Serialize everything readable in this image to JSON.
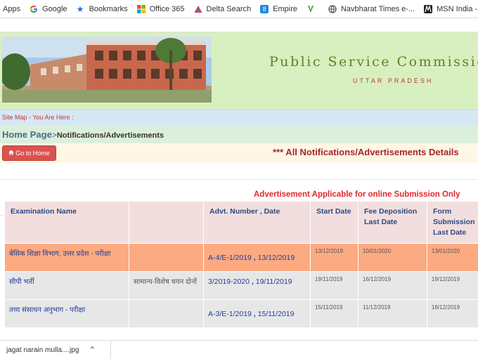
{
  "browser": {
    "bookmarks": [
      {
        "label": "Apps",
        "icon": "apps-icon"
      },
      {
        "label": "Google",
        "icon": "google-icon"
      },
      {
        "label": "Bookmarks",
        "icon": "star-icon"
      },
      {
        "label": "Office 365",
        "icon": "office-icon"
      },
      {
        "label": "Delta Search",
        "icon": "delta-icon"
      },
      {
        "label": "Empire",
        "icon": "empire-icon"
      },
      {
        "label": "",
        "icon": "v-icon"
      },
      {
        "label": "Navbharat Times e-...",
        "icon": "globe-icon"
      },
      {
        "label": "MSN India - News,...",
        "icon": "msn-icon"
      },
      {
        "label": "",
        "icon": "dh-icon"
      }
    ]
  },
  "header": {
    "title": "Public Service Commission",
    "subtitle": "UTTAR PRADESH"
  },
  "sitemap": {
    "text": "Site Map - You Are Here :"
  },
  "breadcrumb": {
    "home": "Home Page",
    "separator": ">",
    "current": "Notifications/Advertisements"
  },
  "actions": {
    "go_home_label": "Go to Home",
    "notifications_title": "*** All Notifications/Advertisements Details"
  },
  "advert": {
    "text": "Advertisement Applicable for online Submission Only"
  },
  "table": {
    "headers": [
      "Examination Name",
      "",
      "Advt. Number , Date",
      "Start Date",
      "Fee Deposition Last Date",
      "Form Submission Last Date"
    ],
    "rows": [
      {
        "name": "बेसिक शिक्षा विभाग, उत्तर प्रदेश - परीक्षा",
        "dept": "",
        "advt": "A-4/E-1/2019",
        "advt_date": "13/12/2019",
        "start": "13/12/2019",
        "fee": "10/01/2020",
        "form": "13/01/2020"
      },
      {
        "name": "सीपी भर्ती",
        "dept": "सामान्य-विशेष चयन दोनों",
        "advt": "3/2019-2020",
        "advt_date": "19/11/2019",
        "start": "19/11/2019",
        "fee": "16/12/2019",
        "form": "19/12/2019"
      },
      {
        "name": "तथ्य संसाधन अनुभाग - परीक्षा",
        "dept": "",
        "advt": "A-3/E-1/2019",
        "advt_date": "15/11/2019",
        "start": "15/11/2019",
        "fee": "11/12/2019",
        "form": "16/12/2019"
      }
    ]
  },
  "downloads": {
    "file": "jagat narain mulla....jpg"
  },
  "colors": {
    "banner_bg": "#d8f0bf",
    "button_red": "#d9534f",
    "row_orange": "#fcaa82",
    "row_gray": "#e7e7e7",
    "accent_red": "#e3262d"
  }
}
